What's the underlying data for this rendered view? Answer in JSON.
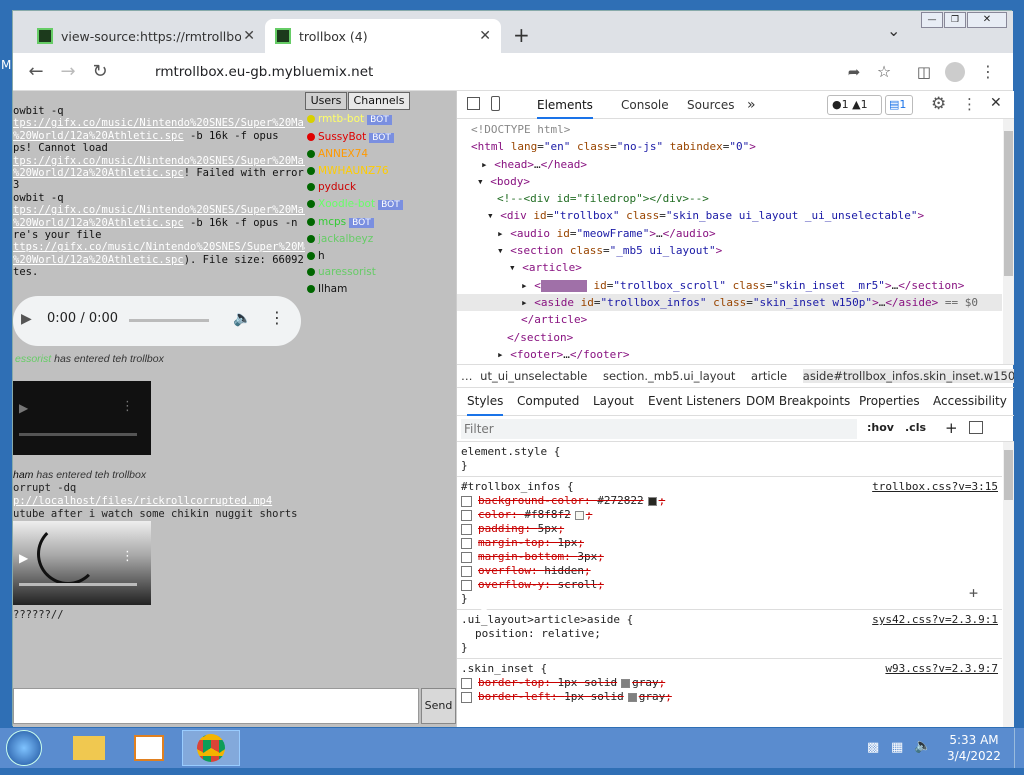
{
  "desktop": {
    "edge_label": "M"
  },
  "window": {
    "min_icon": "—",
    "max_icon": "❐",
    "close_icon": "✕"
  },
  "tabs": [
    {
      "title": "view-source:https://rmtrollbox.eu",
      "close": "✕"
    },
    {
      "title": "trollbox (4)",
      "close": "✕"
    }
  ],
  "new_tab": "+",
  "tab_menu": "⌄",
  "toolbar": {
    "url": "rmtrollbox.eu-gb.mybluemix.net"
  },
  "chat": {
    "lines": [
      {
        "t": "owbit -q"
      },
      {
        "l": "tps://gifx.co/music/Nintendo%20SNES/Super%20Mari"
      },
      {
        "l": "%20World/12a%20Athletic.spc",
        "t": " -b 16k -f opus"
      },
      {
        "t": "ps! Cannot load"
      },
      {
        "l": "tps://gifx.co/music/Nintendo%20SNES/Super%20Mari"
      },
      {
        "l": "%20World/12a%20Athletic.spc",
        "t": "! Failed with error"
      },
      {
        "t": "3"
      },
      {
        "t": "owbit -q"
      },
      {
        "l": "tps://gifx.co/music/Nintendo%20SNES/Super%20Mari"
      },
      {
        "l": "%20World/12a%20Athletic.spc",
        "t": " -b 16k -f opus -n"
      },
      {
        "t": "re's your file"
      },
      {
        "l": "ttps://gifx.co/music/Nintendo%20SNES/Super%20Mar"
      },
      {
        "l": "%20World/12a%20Athletic.spc",
        "t": "). File size: 66092"
      },
      {
        "t": "tes."
      }
    ],
    "audio_time": "0:00 / 0:00",
    "entered1_user": "essorist",
    "entered1_text": " has entered teh trollbox",
    "entered2_user": "ham",
    "entered2_text": " has entered teh trollbox",
    "line_corrupt": "orrupt -dq",
    "line_corrupt_link": "p://localhost/files/rickrollcorrupted.mp4",
    "line_youtube": "utube after i watch some chikin nuggit shorts",
    "line_q": "??????//",
    "send": "Send"
  },
  "users": {
    "tab_users": "Users",
    "tab_channels": "Channels",
    "list": [
      {
        "name": "rmtb-bot",
        "color": "#ffff66",
        "bot": "BOT",
        "dot": "#d8d000"
      },
      {
        "name": "SussyBot",
        "color": "#e00000",
        "bot": "BOT",
        "dot": "#e00000"
      },
      {
        "name": "ANNEX74",
        "color": "#ff9900",
        "dot": "#006600"
      },
      {
        "name": "MWHAUNZ76",
        "color": "#ffcc00",
        "dot": "#006600"
      },
      {
        "name": "pyduck",
        "color": "#cc0000",
        "dot": "#006600"
      },
      {
        "name": "Xoodle-bot",
        "color": "#66ff66",
        "bot": "BOT",
        "dot": "#006600"
      },
      {
        "name": "mcps",
        "color": "#33cc33",
        "bot": "BOT",
        "dot": "#006600"
      },
      {
        "name": "jackalbeyz",
        "color": "#66cc66",
        "dot": "#006600"
      },
      {
        "name": "h",
        "color": "#111111",
        "dot": "#006600"
      },
      {
        "name": "uaressorist",
        "color": "#66cc66",
        "dot": "#006600"
      },
      {
        "name": "Ilham",
        "color": "#111111",
        "dot": "#006600"
      }
    ]
  },
  "devtools": {
    "tabs": [
      "Elements",
      "Console",
      "Sources"
    ],
    "more": "»",
    "badge1": "1",
    "badge2": "1",
    "badge3": "1",
    "doctype": "<!DOCTYPE html>",
    "crumbs": [
      "ut_ui_unselectable",
      "section._mb5.ui_layout",
      "article",
      "aside#trollbox_infos.skin_inset.w150p"
    ],
    "subtabs": [
      "Styles",
      "Computed",
      "Layout",
      "Event Listeners",
      "DOM Breakpoints",
      "Properties",
      "Accessibility"
    ],
    "filter_placeholder": "Filter",
    "hov": ":hov",
    "cls": ".cls",
    "rule1_selector": "element.style {",
    "rule2_selector": "#trollbox_infos {",
    "rule2_source": "trollbox.css?v=3:15",
    "rule2_props": [
      {
        "p": "background-color",
        "v": "#272822",
        "sw": "#272822"
      },
      {
        "p": "color",
        "v": "#f8f8f2",
        "sw": "#f8f8f2"
      },
      {
        "p": "padding",
        "v": "5px"
      },
      {
        "p": "margin-top",
        "v": "1px"
      },
      {
        "p": "margin-bottom",
        "v": "3px"
      },
      {
        "p": "overflow",
        "v": "hidden"
      },
      {
        "p": "overflow-y",
        "v": "scroll"
      }
    ],
    "rule3_selector": ".ui_layout>article>aside {",
    "rule3_source": "sys42.css?v=2.3.9:1",
    "rule3_prop": "position: relative;",
    "rule4_selector": ".skin_inset {",
    "rule4_source": "w93.css?v=2.3.9:7",
    "rule4_props": [
      {
        "p": "border-top",
        "v": "1px solid",
        "sw": "#808080",
        "c": "gray"
      },
      {
        "p": "border-left",
        "v": "1px solid",
        "sw": "#808080",
        "c": "gray"
      }
    ]
  },
  "taskbar": {
    "time": "5:33 AM",
    "date": "3/4/2022"
  }
}
